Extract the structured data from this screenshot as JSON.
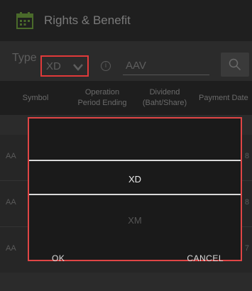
{
  "header": {
    "title": "Rights & Benefit",
    "icon": "calendar-icon"
  },
  "filter": {
    "type_label": "Type",
    "type_value": "XD",
    "symbol_value": "AAV"
  },
  "table": {
    "columns": [
      "Symbol",
      "Operation\nPeriod Ending",
      "Dividend\n(Baht/Share)",
      "Payment Date"
    ],
    "rows": [
      {
        "symbol": "AA",
        "date_tail": "8"
      },
      {
        "symbol": "AA",
        "date_tail": "8"
      },
      {
        "symbol": "AA",
        "date_tail": "7"
      }
    ]
  },
  "dialog": {
    "options": [
      "XD",
      "XM"
    ],
    "selected": "XD",
    "ok_label": "OK",
    "cancel_label": "CANCEL"
  },
  "colors": {
    "accent": "#e04545",
    "background": "#2b2b2b",
    "header": "#1f1f1f"
  }
}
